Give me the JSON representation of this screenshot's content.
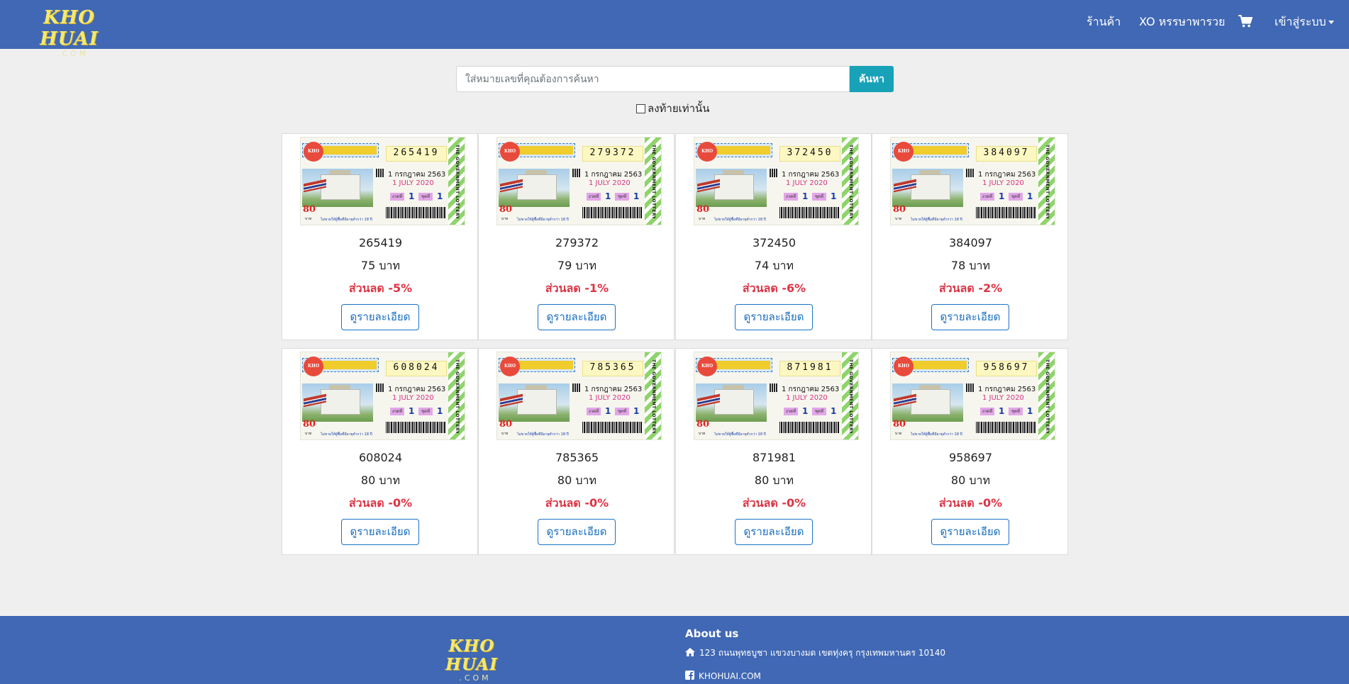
{
  "brand": {
    "logo_main": "KHO HUAI",
    "logo_sub": ".COM"
  },
  "nav": {
    "shop": "ร้านค้า",
    "xo": "XO หรรษาพารวย",
    "cart_icon": "shopping-cart-icon",
    "login": "เข้าสู่ระบบ"
  },
  "search": {
    "placeholder": "ใส่หมายเลขที่คุณต้องการค้นหา",
    "value": "",
    "button": "ค้นหา",
    "suffix_label": "ลงท้ายเท่านั้น",
    "suffix_checked": false
  },
  "ticket_template": {
    "thai_date": "1 กรกฎาคม 2563",
    "english_date": "1 JULY 2020",
    "price_mark": "80",
    "baht_small": "บาท",
    "warning": "ไม่ขายให้ผู้ซื้อที่มีอายุต่ำกว่า 18 ปี",
    "side_text": "THE GOVERNMENT LOTTERY",
    "logo_text": "KHO HUAI",
    "tag_label_1": "งวดที่",
    "tag_label_2": "ชุดที่",
    "tag_value": "1"
  },
  "detail_button": "ดูรายละเอียด",
  "products": [
    {
      "number": "265419",
      "digits": "265419",
      "price": "75 บาท",
      "discount": "ส่วนลด -5%"
    },
    {
      "number": "279372",
      "digits": "279372",
      "price": "79 บาท",
      "discount": "ส่วนลด -1%"
    },
    {
      "number": "372450",
      "digits": "372450",
      "price": "74 บาท",
      "discount": "ส่วนลด -6%"
    },
    {
      "number": "384097",
      "digits": "384097",
      "price": "78 บาท",
      "discount": "ส่วนลด -2%"
    },
    {
      "number": "608024",
      "digits": "608024",
      "price": "80 บาท",
      "discount": "ส่วนลด -0%"
    },
    {
      "number": "785365",
      "digits": "785365",
      "price": "80 บาท",
      "discount": "ส่วนลด -0%"
    },
    {
      "number": "871981",
      "digits": "871981",
      "price": "80 บาท",
      "discount": "ส่วนลด -0%"
    },
    {
      "number": "958697",
      "digits": "958697",
      "price": "80 บาท",
      "discount": "ส่วนลด -0%"
    }
  ],
  "footer": {
    "logo_main": "KHO HUAI",
    "logo_sub": ".COM",
    "about_title": "About us",
    "address_icon": "home-icon",
    "address": "123 ถนนพุทธบูชา แขวงบางมด เขตทุ่งครุ กรุงเทพมหานคร 10140",
    "facebook_icon": "facebook-icon",
    "facebook": "KHOHUAI.COM"
  },
  "colors": {
    "navbar": "#4068b4",
    "logo": "#f6e96a",
    "search_button": "#17a2b8",
    "discount": "#dc3545",
    "detail_button": "#1a73c4",
    "background": "#efefef"
  }
}
